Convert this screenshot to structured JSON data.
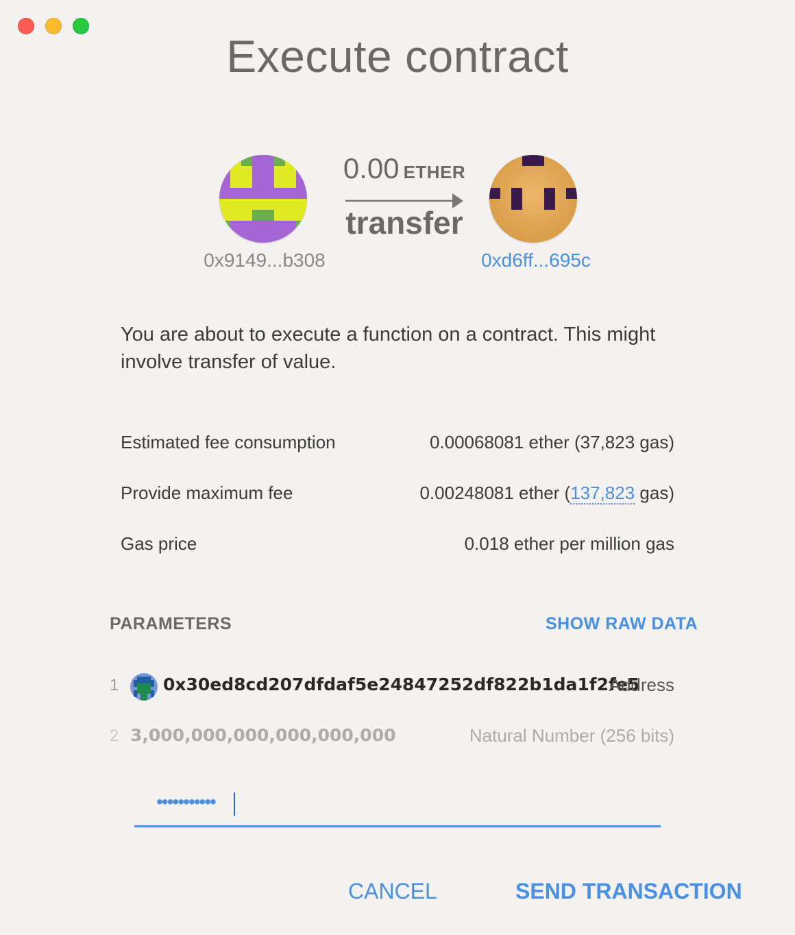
{
  "window": {
    "title": "Execute contract"
  },
  "transfer": {
    "from_address": "0x9149...b308",
    "to_address": "0xd6ff...695c",
    "amount": "0.00",
    "unit": "ETHER",
    "function_name": "transfer"
  },
  "description": "You are about to execute a function on a contract. This might involve transfer of value.",
  "fees": {
    "estimated": {
      "label": "Estimated fee consumption",
      "value": "0.00068081 ether (37,823 gas)"
    },
    "maximum": {
      "label": "Provide maximum fee",
      "value_prefix": "0.00248081 ether (",
      "gas_link": "137,823",
      "value_suffix": " gas)"
    },
    "gas_price": {
      "label": "Gas price",
      "value": "0.018 ether per million gas"
    }
  },
  "parameters": {
    "label": "PARAMETERS",
    "show_raw_label": "SHOW RAW DATA",
    "items": [
      {
        "index": "1",
        "value": "0x30ed8cd207dfdaf5e24847252df822b1da1f2fe5",
        "type": "Address"
      },
      {
        "index": "2",
        "value": "3,000,000,000,000,000,000",
        "type": "Natural Number (256 bits)"
      }
    ]
  },
  "password": {
    "masked_value": "•••••••••••"
  },
  "actions": {
    "cancel": "CANCEL",
    "send": "SEND TRANSACTION"
  },
  "colors": {
    "accent": "#4a90e2",
    "title": "#6b6866",
    "background": "#f3f2f1"
  },
  "icons": [
    "identicon-from",
    "identicon-to",
    "arrow-right-icon",
    "identicon-param"
  ]
}
